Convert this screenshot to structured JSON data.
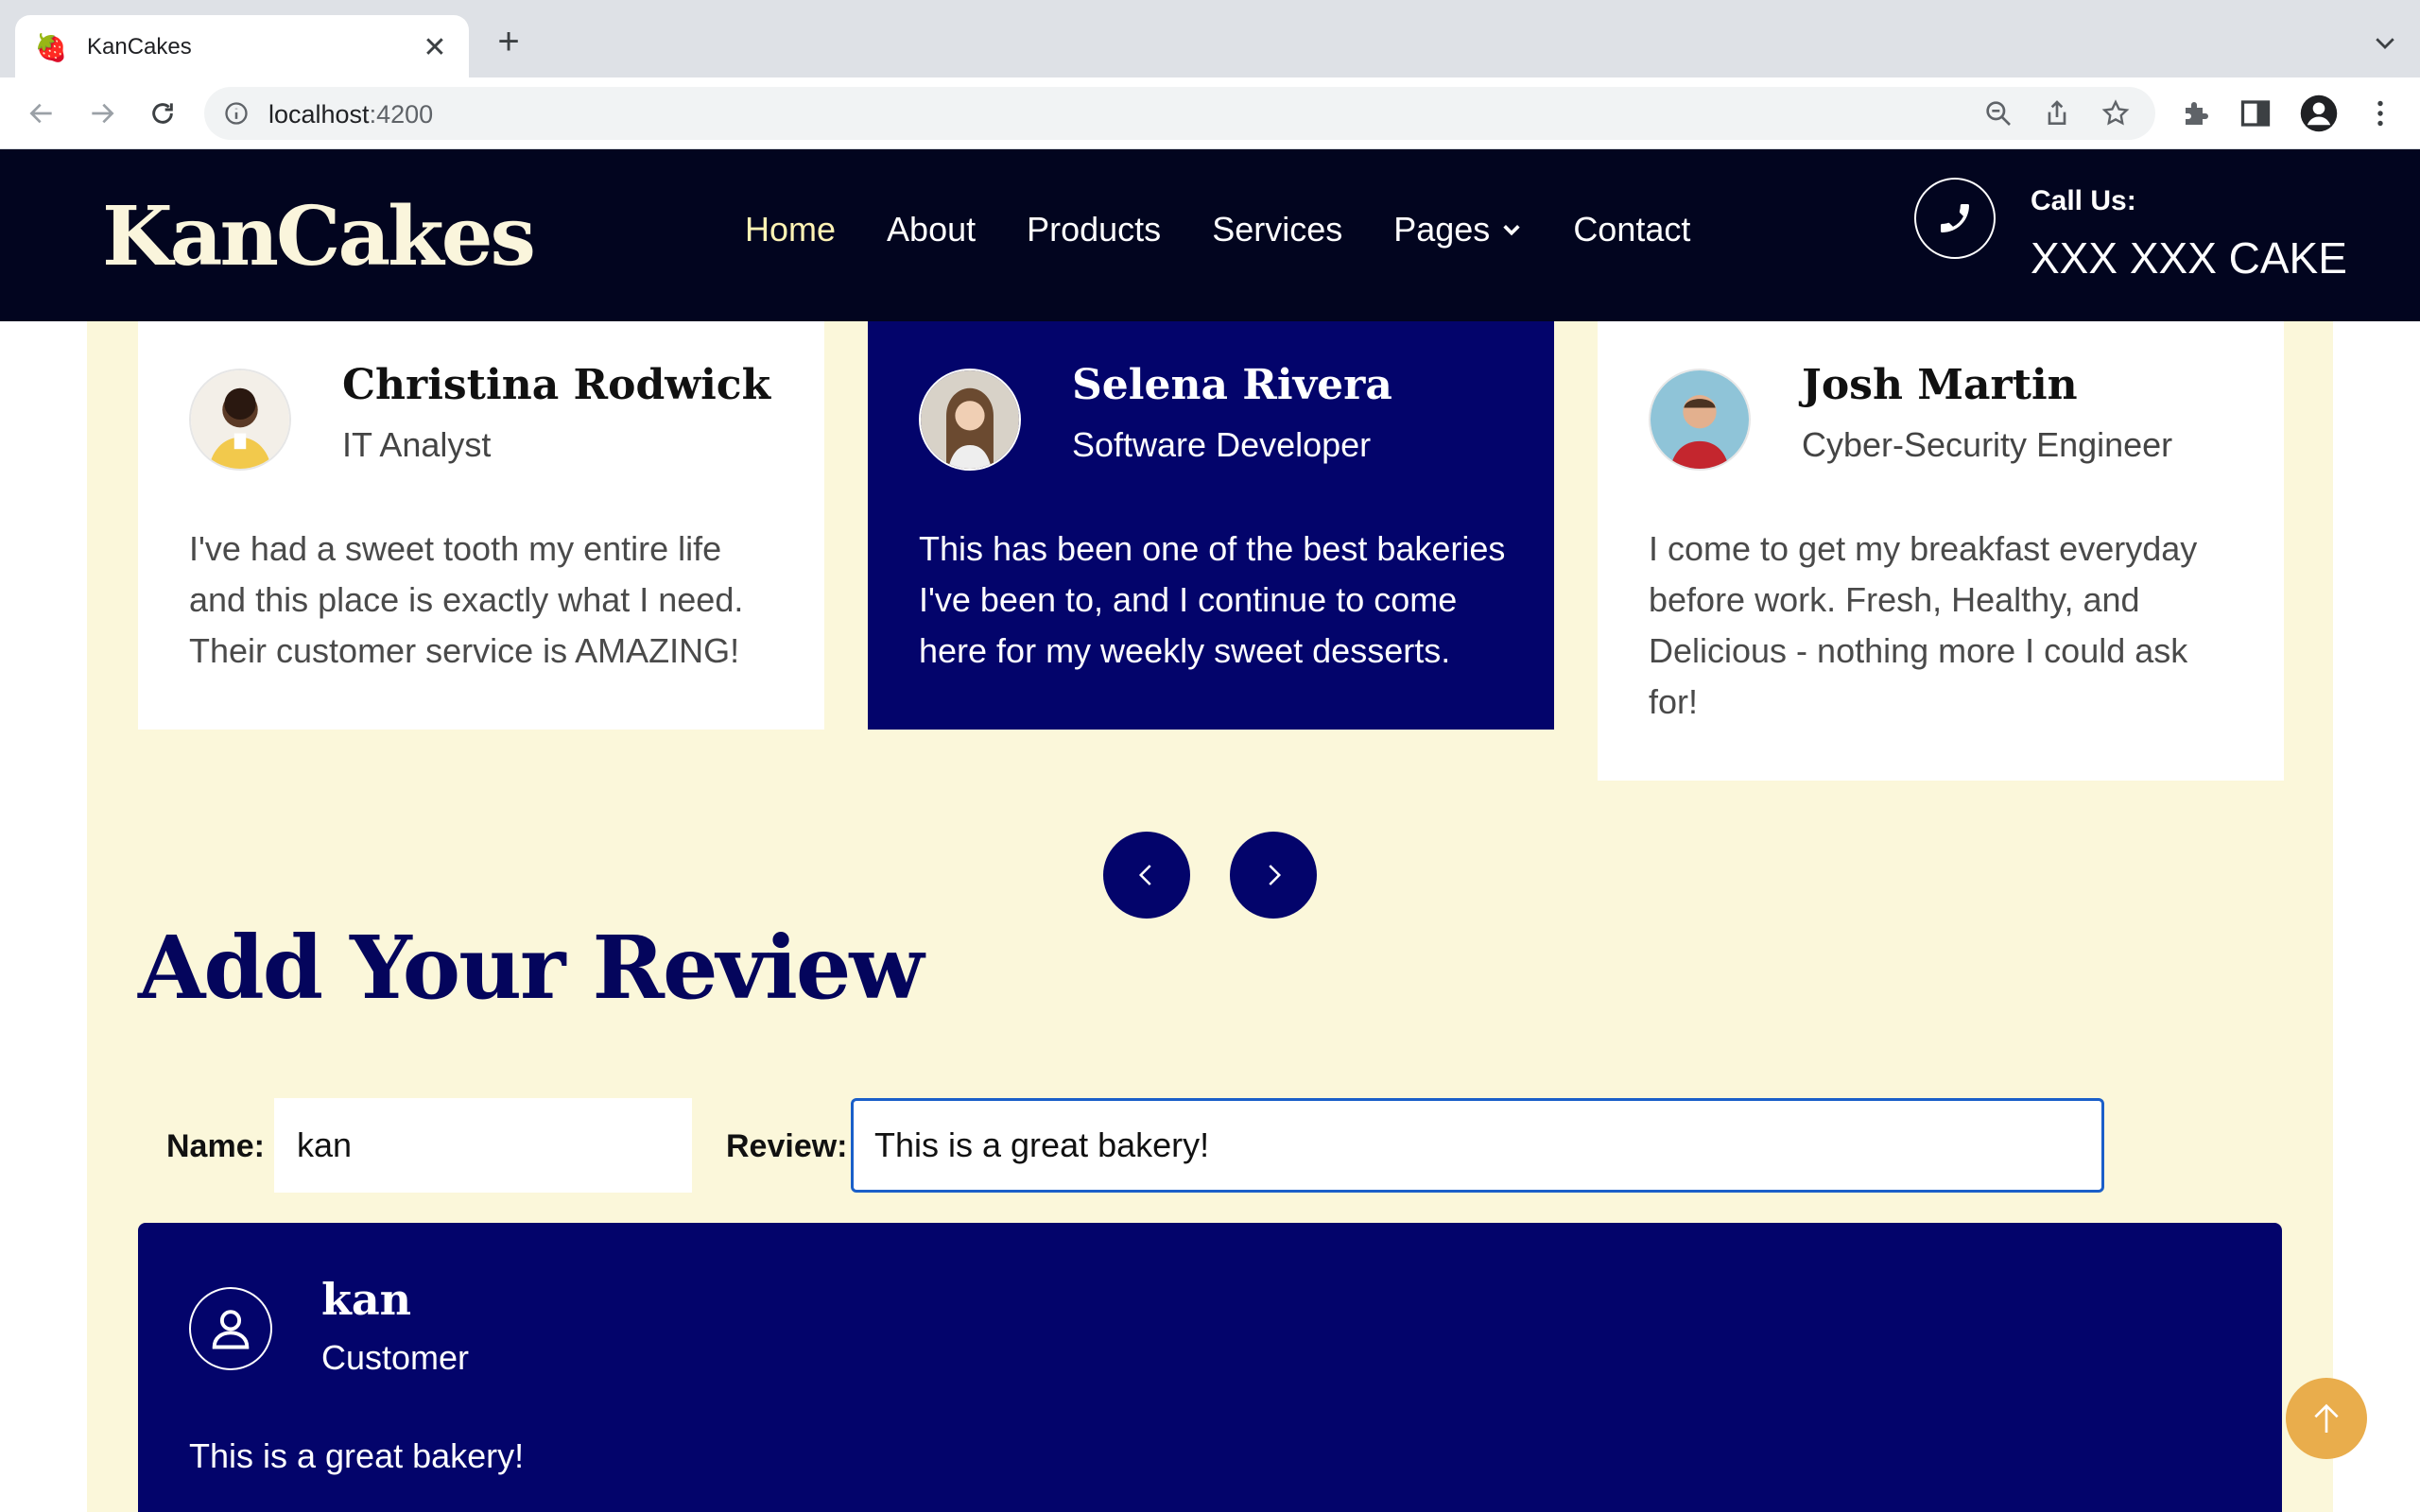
{
  "browser": {
    "tab_title": "KanCakes",
    "url_host": "localhost",
    "url_port": ":4200"
  },
  "site": {
    "logo": "KanCakes",
    "nav": {
      "home": "Home",
      "about": "About",
      "products": "Products",
      "services": "Services",
      "pages": "Pages",
      "contact": "Contact"
    },
    "call_label": "Call Us:",
    "call_number": "XXX XXX CAKE"
  },
  "testimonials": [
    {
      "name": "Christina Rodwick",
      "role": "IT Analyst",
      "quote": "I've had a sweet tooth my entire life and this place is exactly what I need. Their customer service is AMAZING!"
    },
    {
      "name": "Selena Rivera",
      "role": "Software Developer",
      "quote": "This has been one of the best bakeries I've been to, and I continue to come here for my weekly sweet desserts."
    },
    {
      "name": "Josh Martin",
      "role": "Cyber-Security Engineer",
      "quote": "I come to get my breakfast everyday before work. Fresh, Healthy, and Delicious - nothing more I could ask for!"
    }
  ],
  "review_form": {
    "heading": "Add Your Review",
    "name_label": "Name:",
    "name_value": "kan",
    "review_label": "Review:",
    "review_value": "This is a great bakery!"
  },
  "new_review": {
    "name": "kan",
    "role": "Customer",
    "text": "This is a great bakery!"
  },
  "colors": {
    "header_bg": "#02051f",
    "accent_navy": "#03046b",
    "cream": "#fbf7da",
    "scroll_top": "#e9ad4c"
  }
}
